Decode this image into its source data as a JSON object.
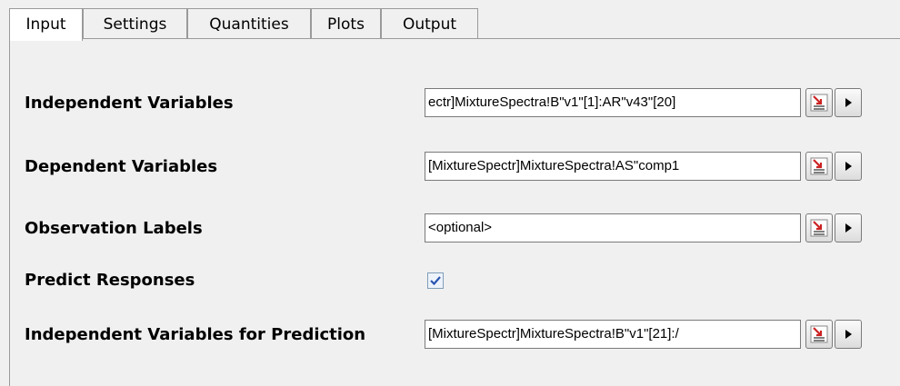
{
  "tabs": [
    {
      "label": "Input",
      "active": true
    },
    {
      "label": "Settings",
      "active": false
    },
    {
      "label": "Quantities",
      "active": false
    },
    {
      "label": "Plots",
      "active": false
    },
    {
      "label": "Output",
      "active": false
    }
  ],
  "rows": [
    {
      "label": "Independent Variables",
      "value": "ectr]MixtureSpectra!B\"v1\"[1]:AR\"v43\"[20]"
    },
    {
      "label": "Dependent Variables",
      "value": "[MixtureSpectr]MixtureSpectra!AS\"comp1"
    },
    {
      "label": "Observation Labels",
      "value": "<optional>"
    },
    {
      "label": "Predict Responses",
      "checked": true
    },
    {
      "label": "Independent Variables for Prediction",
      "value": "[MixtureSpectr]MixtureSpectra!B\"v1\"[21]:/"
    }
  ],
  "icons": {
    "picker": "range-select-icon",
    "arrow": "triangle-right-icon",
    "check": "checkmark-icon"
  },
  "colors": {
    "picker_red": "#cc2222",
    "check_blue": "#2a55b0"
  }
}
